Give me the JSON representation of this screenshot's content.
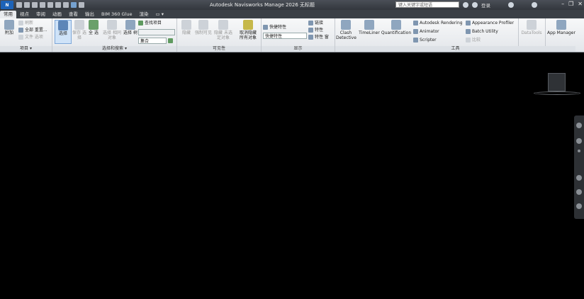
{
  "app": {
    "logo": "N",
    "title": "Autodesk Navisworks Manage 2026   无标题"
  },
  "search": {
    "placeholder": "键入关键字或短语"
  },
  "user": {
    "name": "登录"
  },
  "window_controls": [
    "–",
    "❐",
    "✕"
  ],
  "tabs": [
    "常用",
    "视点",
    "审阅",
    "动画",
    "查看",
    "输出",
    "BIM 360 Glue",
    "渲染",
    "▭ ▾"
  ],
  "ribbon": {
    "project": {
      "label": "项目 ▾",
      "attach": "附加",
      "refresh": "刷新",
      "reset_all": "全部 重置...",
      "file_options": "文件 选项"
    },
    "select": {
      "label": "选择和搜索 ▾",
      "select": "选择",
      "save_selection": "保存 选择",
      "select_all": "全 选",
      "select_same": "选择 相同对象",
      "selection_tree": "选择 树",
      "find_items": "查找项目",
      "sets_combo": "集合"
    },
    "visibility": {
      "label": "可见性",
      "hide": "隐藏",
      "require": "强制可见",
      "hide_unselected": "隐藏 未选定对象",
      "unhide_all": "取消隐藏 所有对象"
    },
    "display": {
      "label": "显示",
      "quick_props": "快捷特性",
      "props_combo": "快捷特性",
      "links": "链接",
      "properties": "特性",
      "dock": "特性 窗"
    },
    "tools": {
      "label": "工具",
      "clash": "Clash Detective",
      "timeliner": "TimeLiner",
      "quantification": "Quantification",
      "autodesk_rendering": "Autodesk Rendering",
      "animator": "Animator",
      "scripter": "Scripter",
      "appearance_profiler": "Appearance Profiler",
      "batch_utility": "Batch Utility",
      "compare": "比较",
      "datatools": "DataTools",
      "app_manager": "App Manager"
    }
  }
}
